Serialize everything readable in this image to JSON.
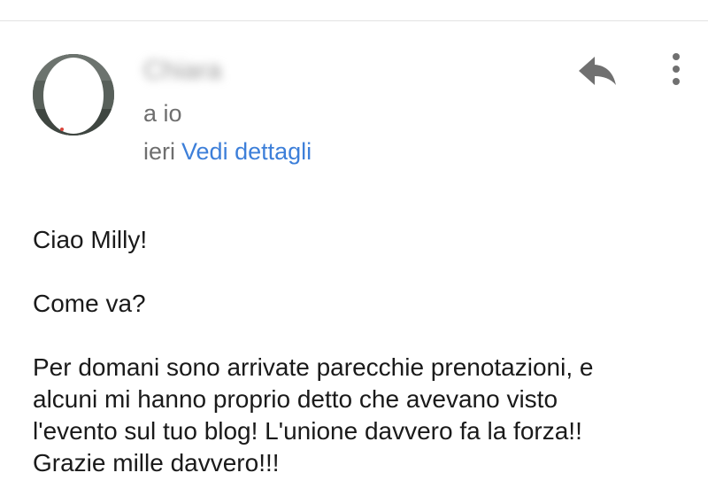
{
  "email": {
    "sender_name": "Chiara",
    "recipient_label": "a io",
    "date_label": "ieri",
    "details_link": "Vedi dettagli"
  },
  "actions": {
    "reply_icon": "reply-icon",
    "more_icon": "more-vert-icon"
  },
  "message": {
    "greeting": "Ciao Milly!",
    "question": "Come va?",
    "paragraph": "Per domani sono arrivate parecchie prenotazioni, e\nalcuni mi hanno proprio detto che avevano visto\nl'evento sul tuo blog! L'unione davvero fa la forza!!\nGrazie mille davvero!!!"
  },
  "colors": {
    "link": "#3d7fd9",
    "secondary_text": "#6e6e6e",
    "body_text": "#1a1a1a",
    "icon": "#707070"
  }
}
